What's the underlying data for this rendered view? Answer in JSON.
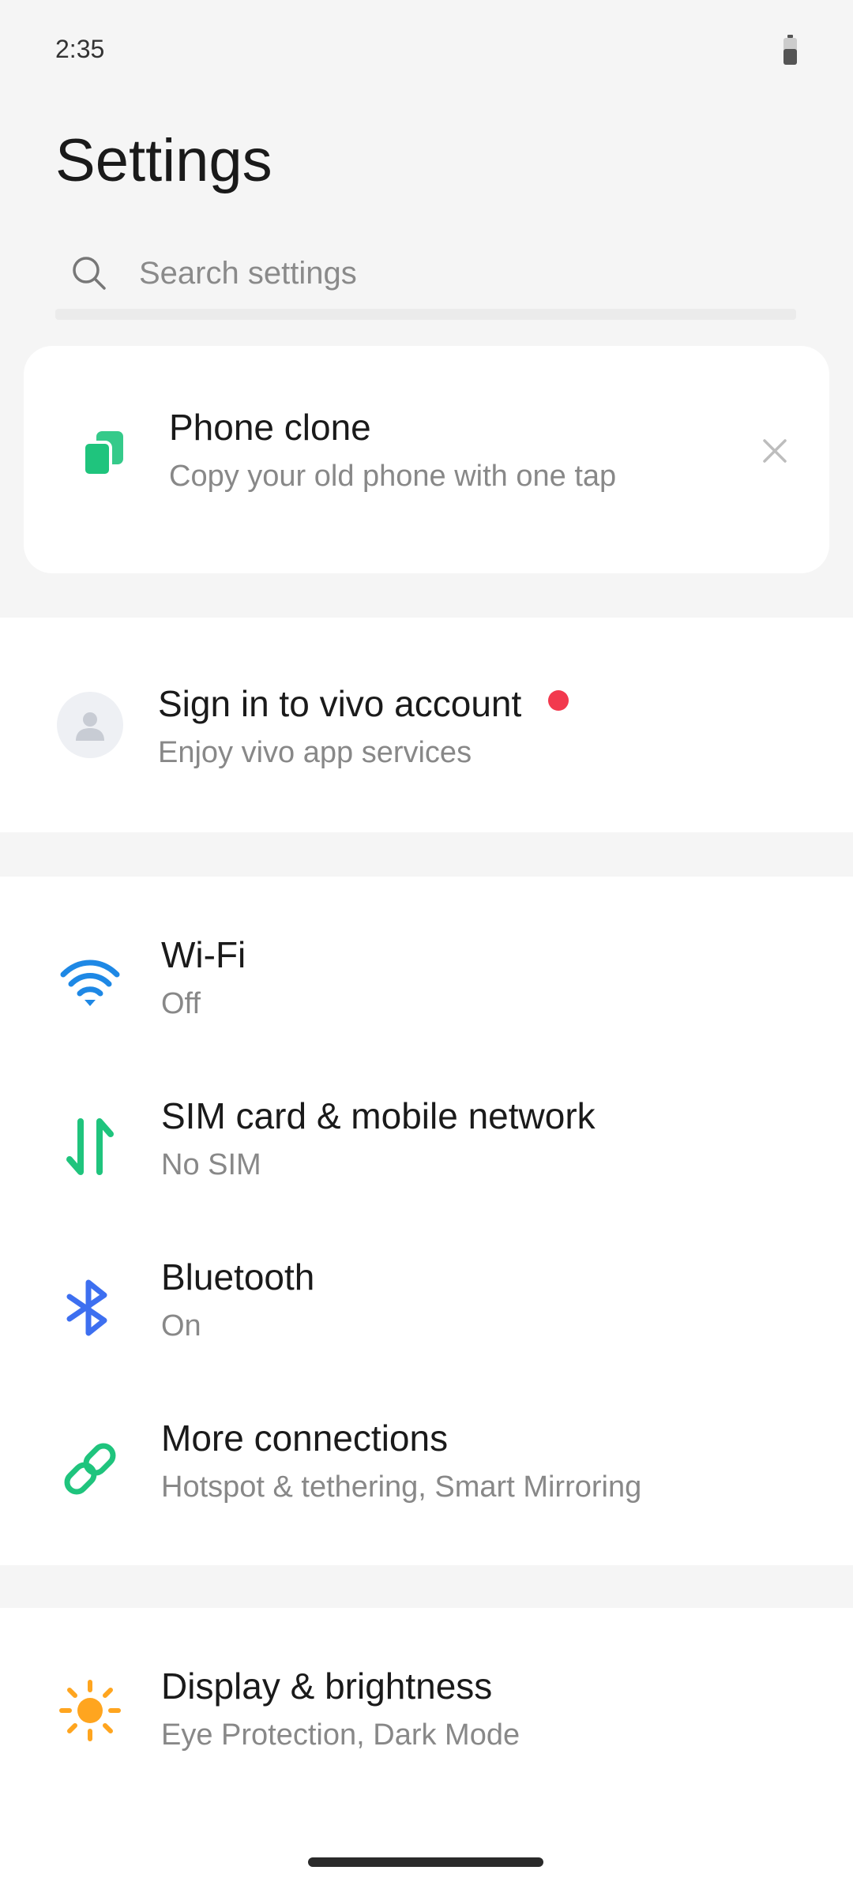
{
  "status": {
    "time": "2:35"
  },
  "header": {
    "title": "Settings"
  },
  "search": {
    "placeholder": "Search settings"
  },
  "phone_clone": {
    "title": "Phone clone",
    "subtitle": "Copy your old phone with one tap",
    "icon": "phone-clone-icon",
    "accent": "#1fc47d"
  },
  "account": {
    "title": "Sign in to vivo account",
    "subtitle": "Enjoy vivo app services",
    "badge_color": "#f2394e"
  },
  "connections": [
    {
      "title": "Wi-Fi",
      "subtitle": "Off",
      "icon": "wifi-icon",
      "color": "#1e88e5"
    },
    {
      "title": "SIM card & mobile network",
      "subtitle": "No SIM",
      "icon": "mobile-data-icon",
      "color": "#1fc47d"
    },
    {
      "title": "Bluetooth",
      "subtitle": "On",
      "icon": "bluetooth-icon",
      "color": "#3d6ff0"
    },
    {
      "title": "More connections",
      "subtitle": "Hotspot & tethering, Smart Mirroring",
      "icon": "link-icon",
      "color": "#1fc47d"
    }
  ],
  "display": [
    {
      "title": "Display & brightness",
      "subtitle": "Eye Protection, Dark Mode",
      "icon": "sun-icon",
      "color": "#ffa51f"
    }
  ]
}
